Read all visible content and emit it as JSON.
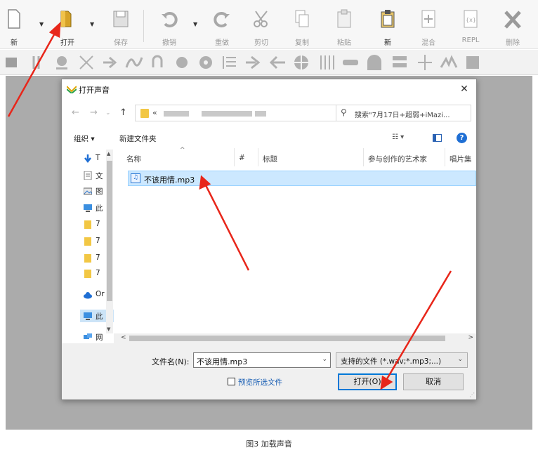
{
  "toolbar": {
    "new_label": "新",
    "open_label": "打开",
    "save_label": "保存",
    "undo_label": "撤销",
    "redo_label": "重做",
    "cut_label": "剪切",
    "copy_label": "复制",
    "paste_label": "粘贴",
    "new2_label": "新",
    "mix_label": "混合",
    "repl_label": "REPL",
    "delete_label": "删除"
  },
  "toolbar2_icons": [
    "audio-icon",
    "split-icon",
    "zoom-icon",
    "scissors-icon",
    "arrow-right-icon",
    "wave-icon",
    "undo-icon",
    "gear-icon",
    "gear2-icon",
    "list-icon",
    "arrow-right2-icon",
    "arrow-left-icon",
    "target-icon",
    "equalizer-icon",
    "minus-icon",
    "arch-icon",
    "stack-icon",
    "merge-icon",
    "peak-icon",
    "misc-icon"
  ],
  "dialog": {
    "title": "打开声音",
    "close_glyph": "✕",
    "address_prefix": "«",
    "search_placeholder": "搜索\"7月17日+超弱+iMazi...",
    "organize_label": "组织 ▾",
    "new_folder_label": "新建文件夹",
    "help_glyph": "?",
    "nav_items": [
      {
        "label": "T",
        "icon": "download-arrow-icon"
      },
      {
        "label": "文",
        "icon": "document-icon"
      },
      {
        "label": "图",
        "icon": "picture-icon"
      },
      {
        "label": "此",
        "icon": "computer-icon"
      },
      {
        "label": "7",
        "icon": "folder-icon"
      },
      {
        "label": "7",
        "icon": "folder-icon"
      },
      {
        "label": "7",
        "icon": "folder-icon"
      },
      {
        "label": "7",
        "icon": "folder-icon"
      },
      {
        "label": "Or",
        "icon": "cloud-icon"
      },
      {
        "label": "此",
        "icon": "computer-icon"
      },
      {
        "label": "网",
        "icon": "network-icon"
      }
    ],
    "columns": [
      "名称",
      "#",
      "标题",
      "参与创作的艺术家",
      "唱片集"
    ],
    "files": [
      {
        "name": "不该用情.mp3"
      }
    ],
    "filename_label": "文件名(N):",
    "filename_value": "不该用情.mp3",
    "filetype_value": "支持的文件 (*.wav;*.mp3;...)",
    "preview_label": "预览所选文件",
    "open_button": "打开(O)",
    "cancel_button": "取消"
  },
  "caption": "图3 加载声音"
}
